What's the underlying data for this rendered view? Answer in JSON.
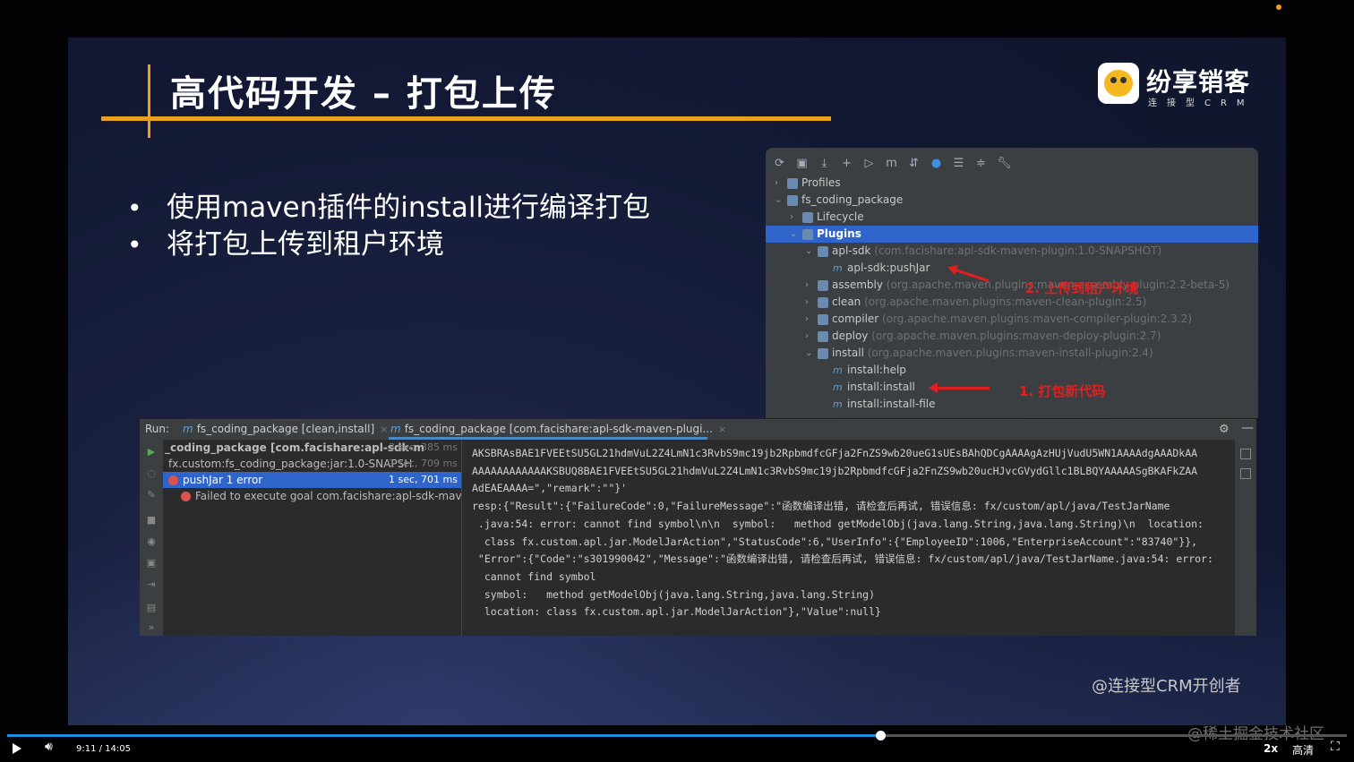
{
  "slide": {
    "title": "高代码开发 – 打包上传",
    "logo_name": "纷享销客",
    "logo_sub": "连接型CRM",
    "bullets": [
      "使用maven插件的install进行编译打包",
      "将打包上传到租户环境"
    ],
    "watermark": "@连接型CRM开创者",
    "accent_color": "#e8a220"
  },
  "maven": {
    "toolbar_icons": [
      "refresh-icon",
      "add-folder-icon",
      "download-icon",
      "plus-icon",
      "run-icon",
      "maven-m-icon",
      "toggle-icon",
      "offline-icon",
      "collapse-icon",
      "expand-icon",
      "wrench-icon"
    ],
    "tree": [
      {
        "indent": 0,
        "chev": "›",
        "label": "Profiles",
        "dim": ""
      },
      {
        "indent": 0,
        "chev": "⌄",
        "label": "fs_coding_package",
        "dim": ""
      },
      {
        "indent": 1,
        "chev": "›",
        "label": "Lifecycle",
        "dim": ""
      },
      {
        "indent": 1,
        "chev": "⌄",
        "label": "Plugins",
        "dim": "",
        "selected": true
      },
      {
        "indent": 2,
        "chev": "⌄",
        "label": "apl-sdk",
        "dim": "(com.facishare:apl-sdk-maven-plugin:1.0-SNAPSHOT)"
      },
      {
        "indent": 3,
        "chev": "",
        "label": "apl-sdk:pushJar",
        "dim": "",
        "goal": true
      },
      {
        "indent": 2,
        "chev": "›",
        "label": "assembly",
        "dim": "(org.apache.maven.plugins:maven-assembly-plugin:2.2-beta-5)"
      },
      {
        "indent": 2,
        "chev": "›",
        "label": "clean",
        "dim": "(org.apache.maven.plugins:maven-clean-plugin:2.5)"
      },
      {
        "indent": 2,
        "chev": "›",
        "label": "compiler",
        "dim": "(org.apache.maven.plugins:maven-compiler-plugin:2.3.2)"
      },
      {
        "indent": 2,
        "chev": "›",
        "label": "deploy",
        "dim": "(org.apache.maven.plugins:maven-deploy-plugin:2.7)"
      },
      {
        "indent": 2,
        "chev": "⌄",
        "label": "install",
        "dim": "(org.apache.maven.plugins:maven-install-plugin:2.4)"
      },
      {
        "indent": 3,
        "chev": "",
        "label": "install:help",
        "dim": "",
        "goal": true
      },
      {
        "indent": 3,
        "chev": "",
        "label": "install:install",
        "dim": "",
        "goal": true
      },
      {
        "indent": 3,
        "chev": "",
        "label": "install:install-file",
        "dim": "",
        "goal": true
      }
    ],
    "annotation_upload": "2. 上传到租户环境",
    "annotation_package": "1. 打包新代码",
    "annotation_color": "#e02020"
  },
  "run": {
    "label": "Run:",
    "tab1": "fs_coding_package [clean,install]",
    "tab2": "fs_coding_package [com.facishare:apl-sdk-maven-plugi...",
    "tree": [
      {
        "text": "_coding_package [com.facishare:apl-sdk-m",
        "time": "3 sec, 385 ms",
        "bold": true
      },
      {
        "text": "fx.custom:fs_coding_package:jar:1.0-SNAPSH",
        "time": "1 sec, 709 ms"
      },
      {
        "text": "pushJar  1 error",
        "time": "1 sec, 701 ms",
        "selected": true,
        "error": true
      },
      {
        "text": "Failed to execute goal com.facishare:apl-sdk-maven-pl",
        "time": "",
        "error": true
      }
    ],
    "console": [
      "AKSBRAsBAE1FVEEtSU5GL21hdmVuL2Z4LmN1c3RvbS9mc19jb2RpbmdfcGFja2FnZS9wb20ueG1sUEsBAhQDCgAAAAgAzHUjVudU5WN1AAAAdgAAADkAA",
      "AAAAAAAAAAAAKSBUQ8BAE1FVEEtSU5GL21hdmVuL2Z4LmN1c3RvbS9mc19jb2RpbmdfcGFja2FnZS9wb20ucHJvcGVydGllc1BLBQYAAAAASgBKAFkZAA",
      "AdEAEAAAA=\",\"remark\":\"\"}'",
      "resp:{\"Result\":{\"FailureCode\":0,\"FailureMessage\":\"函数编译出错, 请检查后再试, 错误信息: fx/custom/apl/java/TestJarName",
      " .java:54: error: cannot find symbol\\n\\n  symbol:   method getModelObj(java.lang.String,java.lang.String)\\n  location:",
      "  class fx.custom.apl.jar.ModelJarAction\",\"StatusCode\":6,\"UserInfo\":{\"EmployeeID\":1006,\"EnterpriseAccount\":\"83740\"}},",
      " \"Error\":{\"Code\":\"s301990042\",\"Message\":\"函数编译出错, 请检查后再试, 错误信息: fx/custom/apl/java/TestJarName.java:54: error:",
      "  cannot find symbol",
      "  symbol:   method getModelObj(java.lang.String,java.lang.String)",
      "  location: class fx.custom.apl.jar.ModelJarAction\"},\"Value\":null}"
    ]
  },
  "player": {
    "time": "9:11 / 14:05",
    "progress": 0.652,
    "speed": "2x",
    "quality": "高清",
    "site_watermark": "@稀土掘金技术社区"
  }
}
